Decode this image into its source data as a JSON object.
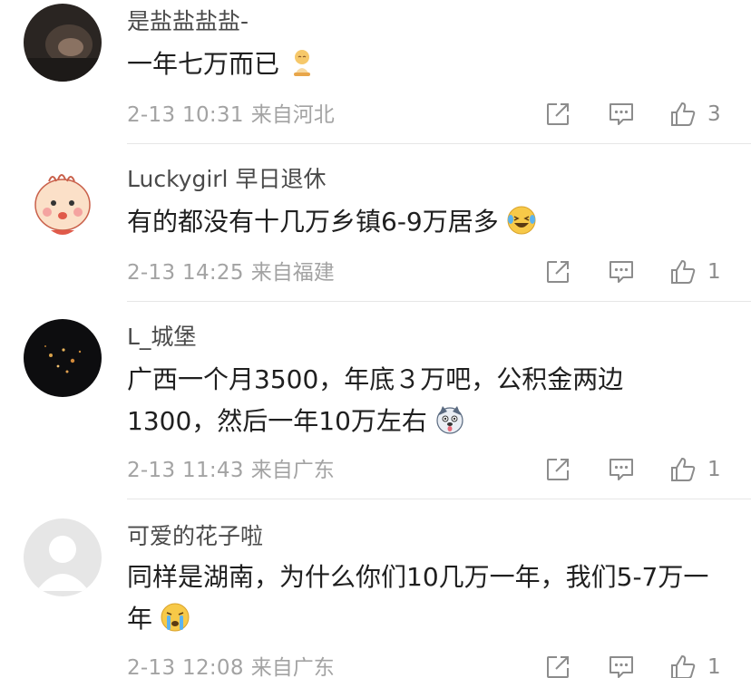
{
  "comments": [
    {
      "username": "是盐盐盐盐-",
      "text": "一年七万而已",
      "emoji": "baby-pray-emoji",
      "time": "2-13 10:31",
      "location": "来自河北",
      "likes": "3"
    },
    {
      "username": "Luckygirl 早日退休",
      "text": "有的都没有十几万乡镇6-9万居多",
      "emoji": "laugh-cry-emoji",
      "time": "2-13 14:25",
      "location": "来自福建",
      "likes": "1"
    },
    {
      "username": "L_城堡",
      "text": "广西一个月3500，年底３万吧，公积金两边1300，然后一年10万左右",
      "emoji": "husky-emoji",
      "time": "2-13 11:43",
      "location": "来自广东",
      "likes": "1"
    },
    {
      "username": "可爱的花子啦",
      "text": "同样是湖南，为什么你们10几万一年，我们5-7万一年",
      "emoji": "crying-emoji",
      "time": "2-13 12:08",
      "location": "来自广东",
      "likes": "1"
    }
  ],
  "colors": {
    "username": "#4a4a4a",
    "text": "#1f1f1f",
    "meta": "#a3a3a3",
    "icon": "#8c8c8c",
    "divider": "#e6e6e6"
  }
}
